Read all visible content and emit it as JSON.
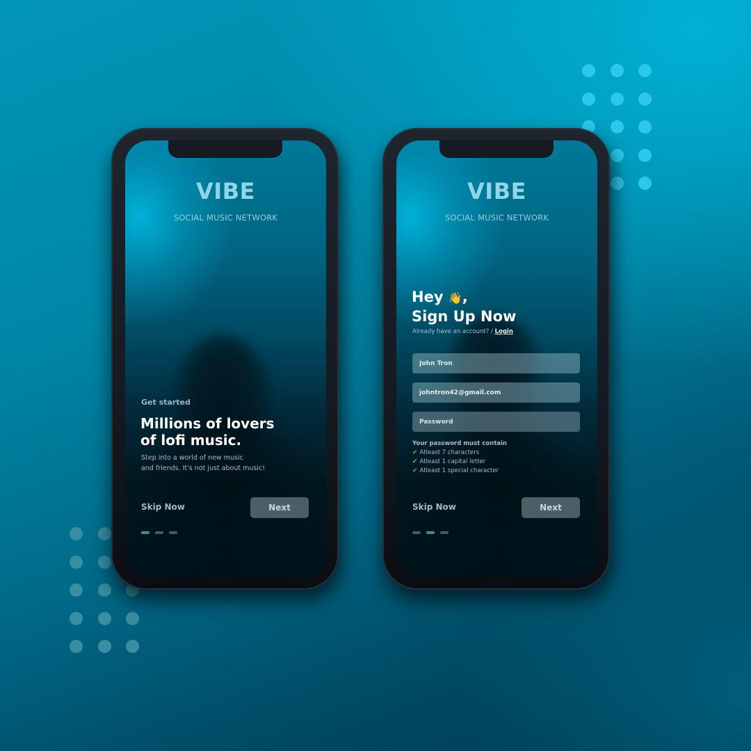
{
  "app": {
    "name": "VIBE",
    "tagline": "SOCIAL MUSIC NETWORK"
  },
  "colors": {
    "background_accent": "#00a8cc",
    "logo": "#8fd6e6",
    "button_bg": "#4d5f66",
    "pager_active": "#3d8aa1",
    "check": "#3fbf4a",
    "wave_emoji": "#f3c340"
  },
  "screens": [
    {
      "id": "get-started",
      "eyebrow": "Get started",
      "headline": "Millions of lovers\nof lofi music.",
      "subtext": "Step into a world of new music\nand friends. It's not just about music!",
      "skip_label": "Skip Now",
      "next_label": "Next",
      "pager": {
        "total": 3,
        "active_index": 0
      }
    },
    {
      "id": "sign-up",
      "greeting_line1": "Hey",
      "greeting_emoji": "👋",
      "greeting_comma": ",",
      "greeting_line2": "Sign Up Now",
      "account_prompt": "Already have an account? /",
      "login_label": "Login",
      "fields": {
        "name_value": "John Tron",
        "email_value": "johntron42@gmail.com",
        "password_placeholder": "Password"
      },
      "password_rules_title": "Your password must contain",
      "password_rules": [
        {
          "icon": "check-icon",
          "text": "Atleast 7 characters"
        },
        {
          "icon": "check-icon",
          "text": "Atleast 1 capital letter"
        },
        {
          "icon": "check-icon",
          "text": "Atleast 1 special character"
        }
      ],
      "skip_label": "Skip Now",
      "next_label": "Next",
      "pager": {
        "total": 3,
        "active_index": 1
      }
    }
  ],
  "decor": {
    "dot_grids": [
      {
        "name": "top-right-dots",
        "rows": 5,
        "cols": 3
      },
      {
        "name": "bottom-left-dots",
        "rows": 5,
        "cols": 3
      }
    ]
  }
}
